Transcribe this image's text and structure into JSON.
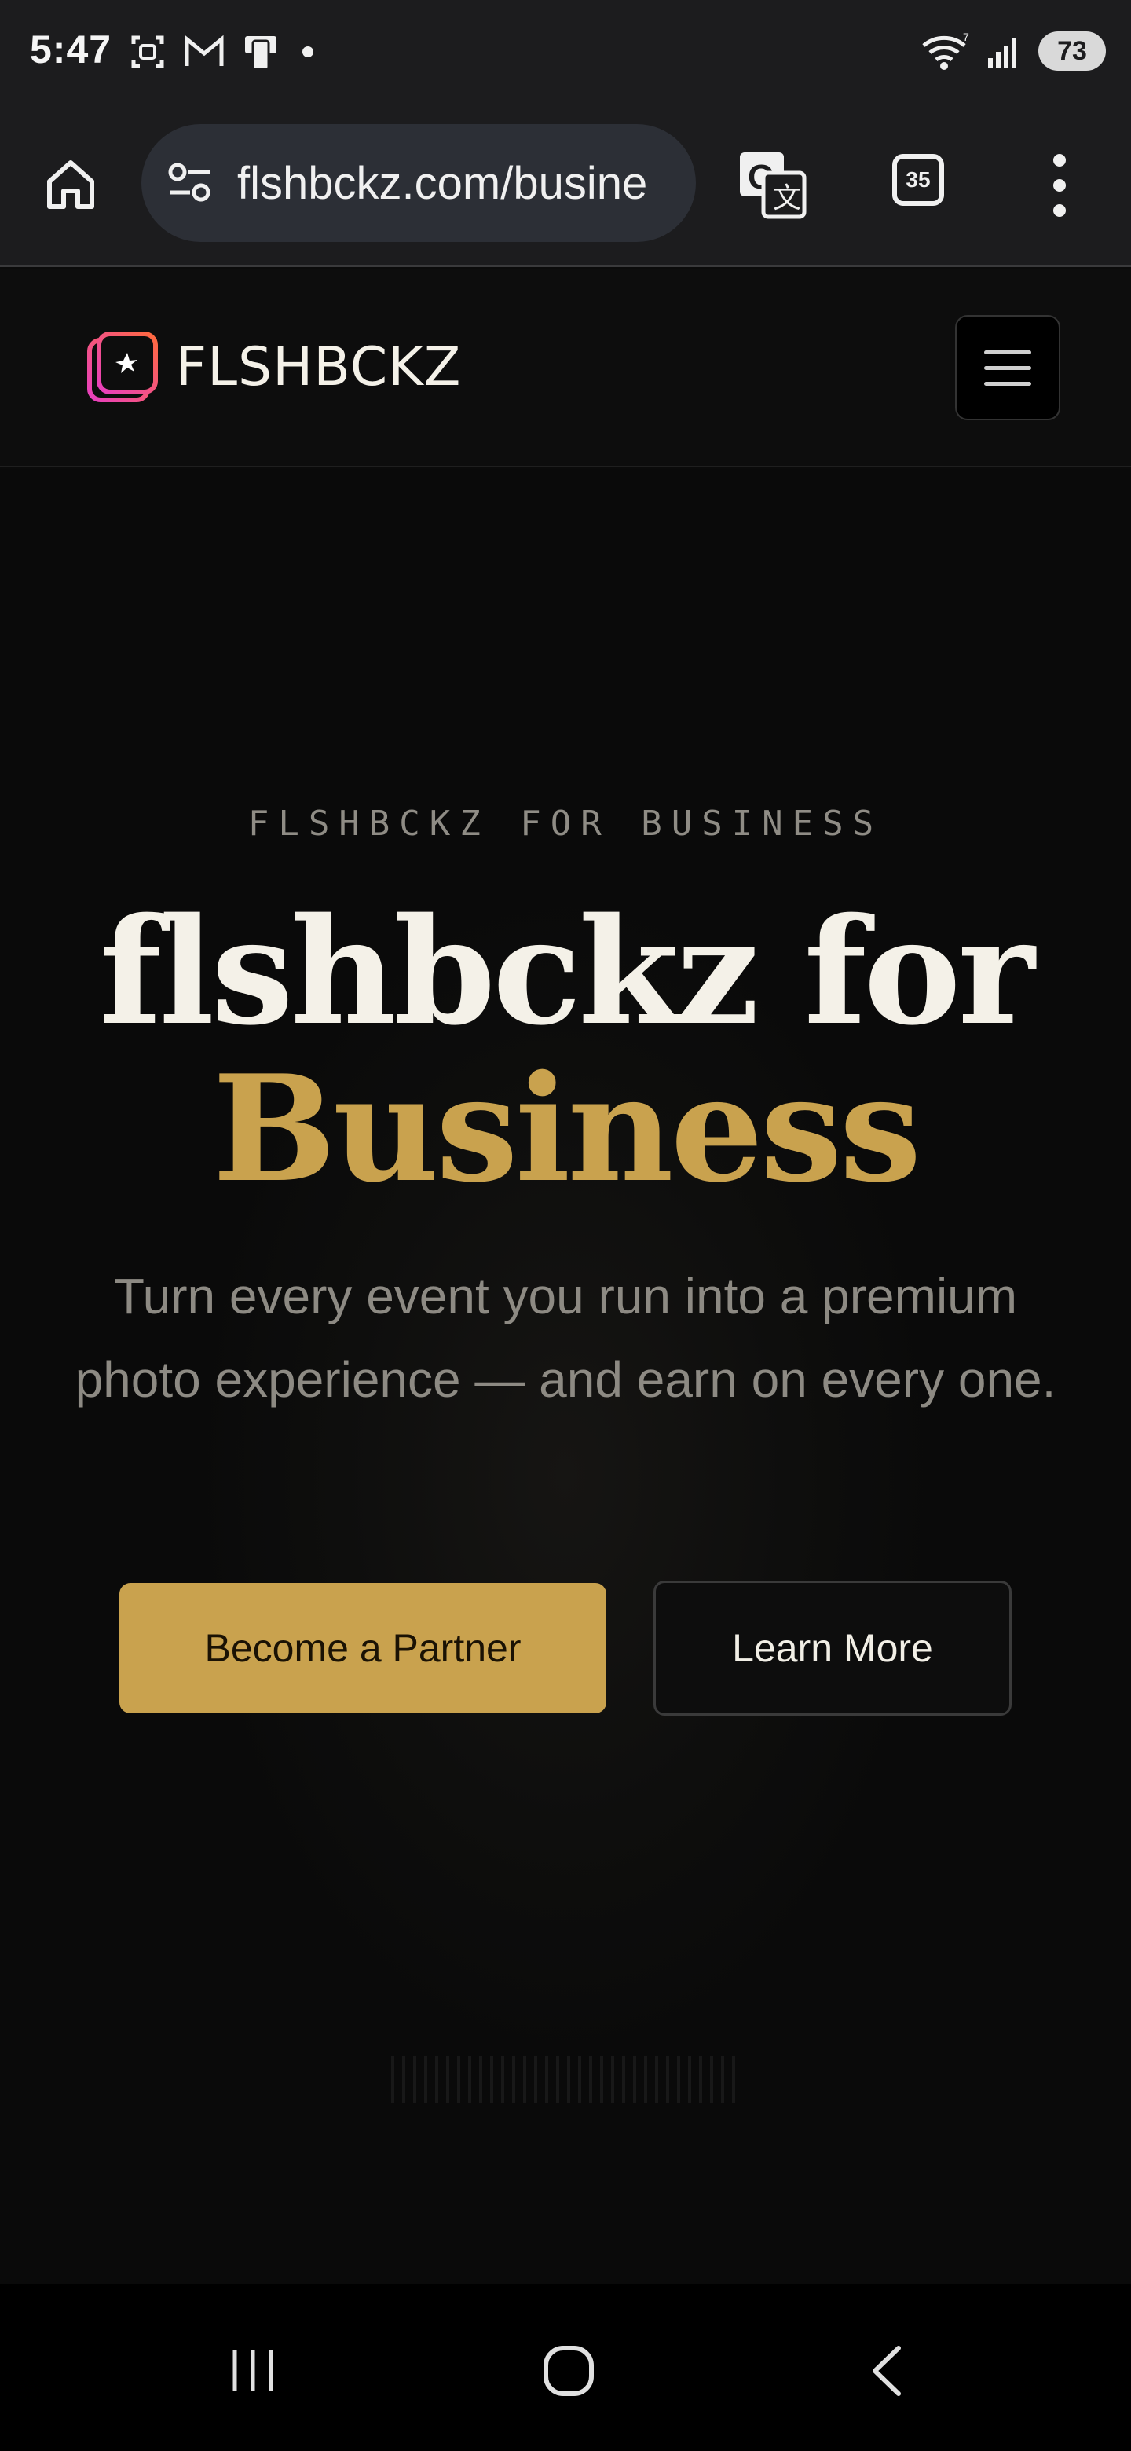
{
  "status_bar": {
    "time": "5:47",
    "battery": "73",
    "icons_left": [
      "screenshot-icon",
      "gmail-icon",
      "device-icon",
      "dot-icon"
    ],
    "icons_right": [
      "wifi-icon",
      "signal-icon",
      "battery-icon"
    ]
  },
  "browser": {
    "url": "flshbckz.com/busine",
    "tab_count": "35",
    "icons": [
      "home-icon",
      "site-settings-icon",
      "translate-icon",
      "tabs-icon",
      "more-menu-icon"
    ]
  },
  "site": {
    "logo_text": "FLSHBCKZ",
    "menu_icon": "hamburger-icon"
  },
  "hero": {
    "eyebrow": "FLSHBCKZ FOR BUSINESS",
    "headline_line1": "flshbckz for",
    "headline_accent": "Business",
    "subhead": "Turn every event you run into a premium photo experience — and earn on every one.",
    "primary_button": "Become a Partner",
    "secondary_button": "Learn More"
  },
  "colors": {
    "accent": "#c9a24e",
    "background": "#0b0b0b",
    "text": "#f4f1e8",
    "muted_text": "#8d8a83",
    "logo_gradient": [
      "#e83fc0",
      "#ff6a3d"
    ]
  },
  "nav": {
    "icons": [
      "recent-apps-icon",
      "home-nav-icon",
      "back-icon"
    ]
  }
}
